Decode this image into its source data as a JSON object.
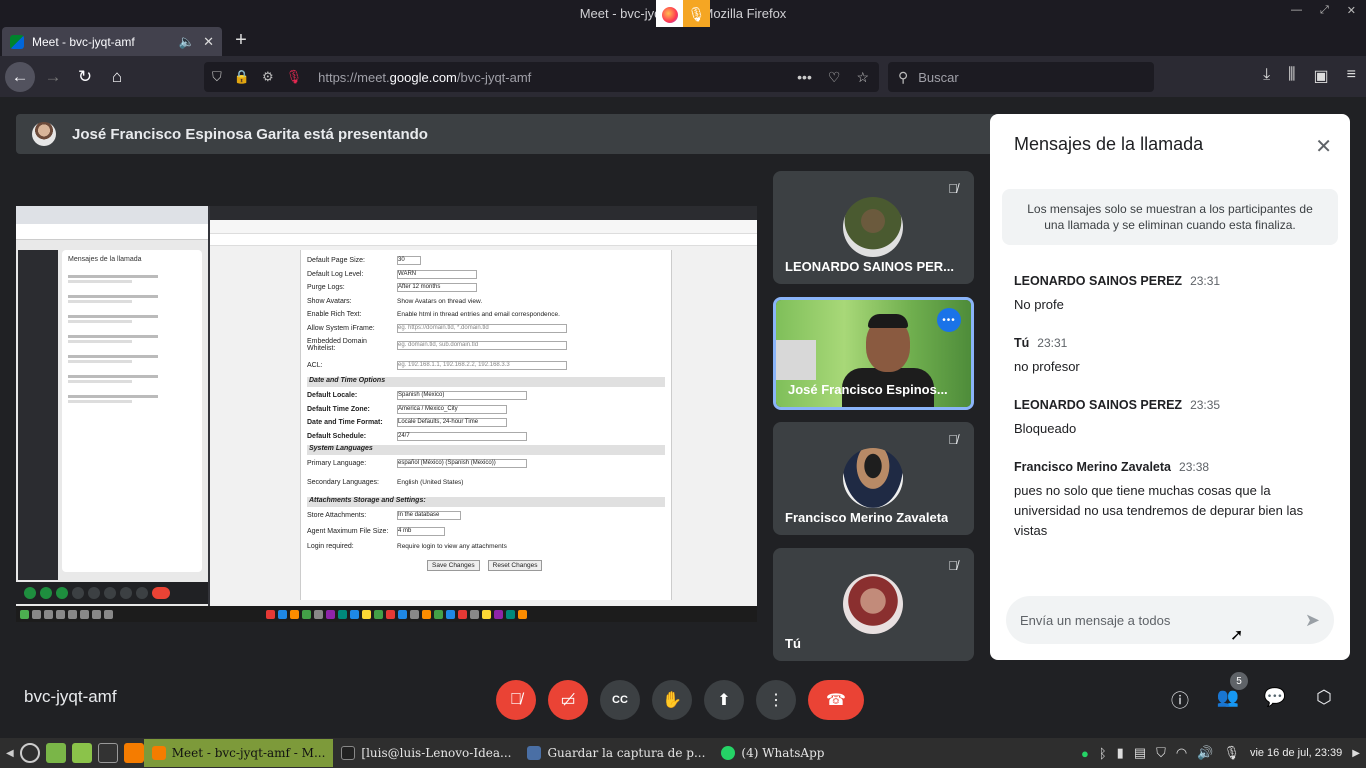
{
  "window": {
    "title": "Meet - bvc-jyqt-amf - Mozilla Firefox",
    "controls": [
      "—",
      "⤢",
      "✕"
    ]
  },
  "tab": {
    "title": "Meet - bvc-jyqt-amf",
    "new_tab": "+"
  },
  "urlbar": {
    "url_prefix": "https://meet.",
    "url_domain": "google.com",
    "url_path": "/bvc-jyqt-amf"
  },
  "searchbar": {
    "placeholder": "Buscar"
  },
  "presenter_banner": {
    "text": "José Francisco Espinosa Garita está presentando"
  },
  "shared_screen": {
    "chat_title": "Mensajes de la llamada",
    "form_rows": [
      {
        "label": "Default Page Size:",
        "value": "30"
      },
      {
        "label": "Default Log Level:",
        "value": "WARN"
      },
      {
        "label": "Purge Logs:",
        "value": "After 12 months"
      },
      {
        "label": "Show Avatars:",
        "value": "Show Avatars on thread view."
      },
      {
        "label": "Enable Rich Text:",
        "value": "Enable html in thread entries and email correspondence."
      },
      {
        "label": "Allow System iFrame:",
        "value": "eg. https://domain.tld, *.domain.tld"
      },
      {
        "label": "Embedded Domain Whitelist:",
        "value": "eg. domain.tld, sub.domain.tld"
      },
      {
        "label": "ACL:",
        "value": "eg. 192.168.1.1, 192.168.2.2, 192.168.3.3"
      }
    ],
    "section_datetime": "Date and Time Options",
    "datetime_rows": [
      {
        "label": "Default Locale:",
        "value": "Spanish (Mexico)"
      },
      {
        "label": "Default Time Zone:",
        "value": "America / Mexico_City"
      },
      {
        "label": "Date and Time Format:",
        "value": "Locale Defaults, 24-hour Time"
      },
      {
        "label": "Default Schedule:",
        "value": "24/7"
      }
    ],
    "section_languages": "System Languages",
    "language_rows": [
      {
        "label": "Primary Language:",
        "value": "español (México) (Spanish (Mexico))"
      },
      {
        "label": "Secondary Languages:",
        "value": "English (United States)"
      }
    ],
    "section_attachments": "Attachments Storage and Settings:",
    "attachment_rows": [
      {
        "label": "Store Attachments:",
        "value": "In the database"
      },
      {
        "label": "Agent Maximum File Size:",
        "value": "4 mb"
      },
      {
        "label": "Login required:",
        "value": "Require login to view any attachments"
      }
    ],
    "save_button": "Save Changes",
    "reset_button": "Reset Changes"
  },
  "participants": [
    {
      "name": "LEONARDO SAINOS PER...",
      "muted": true
    },
    {
      "name": "José Francisco Espinos...",
      "muted": false,
      "speaking": true
    },
    {
      "name": "Francisco Merino Zavaleta",
      "muted": true
    },
    {
      "name": "Tú",
      "muted": true
    }
  ],
  "chat": {
    "title": "Mensajes de la llamada",
    "notice": "Los mensajes solo se muestran a los participantes de una llamada y se eliminan cuando esta finaliza.",
    "messages": [
      {
        "sender": "LEONARDO SAINOS PEREZ",
        "time": "23:31",
        "text": "No profe"
      },
      {
        "sender": "Tú",
        "time": "23:31",
        "text": "no profesor"
      },
      {
        "sender": "LEONARDO SAINOS PEREZ",
        "time": "23:35",
        "text": "Bloqueado"
      },
      {
        "sender": "Francisco Merino Zavaleta",
        "time": "23:38",
        "text": "pues no solo que tiene muchas cosas que la universidad no usa tendremos de depurar bien las vistas"
      }
    ],
    "input_placeholder": "Envía un mensaje a todos"
  },
  "meeting": {
    "code": "bvc-jyqt-amf",
    "participant_count": "5"
  },
  "taskbar": {
    "items": [
      {
        "label": "Meet - bvc-jyqt-amf - M...",
        "active": true
      },
      {
        "label": "[luis@luis-Lenovo-Idea...",
        "active": false
      },
      {
        "label": "Guardar la captura de p...",
        "active": false
      },
      {
        "label": "(4) WhatsApp",
        "active": false
      }
    ],
    "clock": "vie 16 de jul, 23:39"
  },
  "colors": {
    "accent": "#8ab4f8",
    "danger": "#ea4335",
    "meet_bg": "#202124",
    "taskbar_active": "#7d9a3a"
  }
}
